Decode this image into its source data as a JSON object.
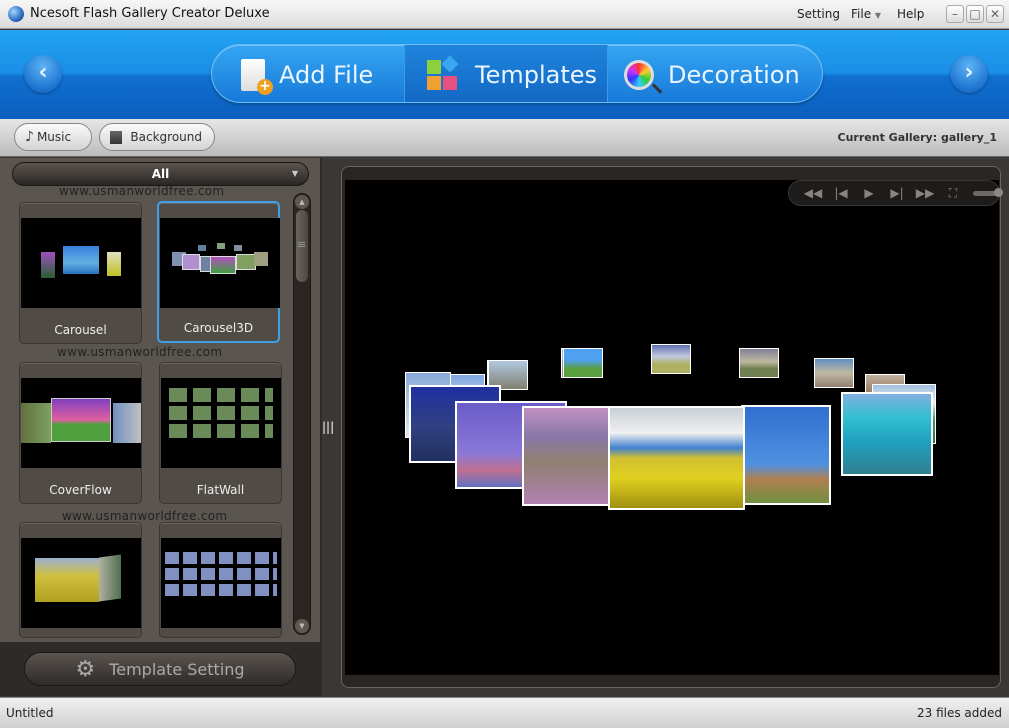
{
  "window": {
    "title": "Ncesoft Flash Gallery Creator Deluxe",
    "menus": [
      "Setting",
      "File",
      "Help"
    ],
    "controls": [
      "minimize",
      "maximize",
      "close"
    ]
  },
  "header": {
    "prev_icon": "chevron-left-icon",
    "next_icon": "chevron-right-icon",
    "tabs": [
      {
        "label": "Add File",
        "icon": "add-file-icon",
        "active": false
      },
      {
        "label": "Templates",
        "icon": "templates-icon",
        "active": true
      },
      {
        "label": "Decoration",
        "icon": "decoration-icon",
        "active": false
      }
    ]
  },
  "toolbar": {
    "music_label": "Music",
    "background_label": "Background",
    "current_gallery": "Current Gallery: gallery_1"
  },
  "templates": {
    "filter": "All",
    "watermark": "www.usmanworldfree.com",
    "items": [
      {
        "label": "Carousel",
        "selected": false
      },
      {
        "label": "Carousel3D",
        "selected": true
      },
      {
        "label": "CoverFlow",
        "selected": false
      },
      {
        "label": "FlatWall",
        "selected": false
      },
      {
        "label": "",
        "selected": false
      },
      {
        "label": "",
        "selected": false
      }
    ],
    "setting_button": "Template Setting"
  },
  "player": {
    "controls": [
      "rewind",
      "previous",
      "play",
      "next",
      "fast-forward",
      "fullscreen",
      "volume"
    ],
    "colors": {
      "selected": "#3ba0e8",
      "accent_blue": "#1a8fe6"
    }
  },
  "status": {
    "left": "Untitled",
    "right": "23 files added"
  }
}
